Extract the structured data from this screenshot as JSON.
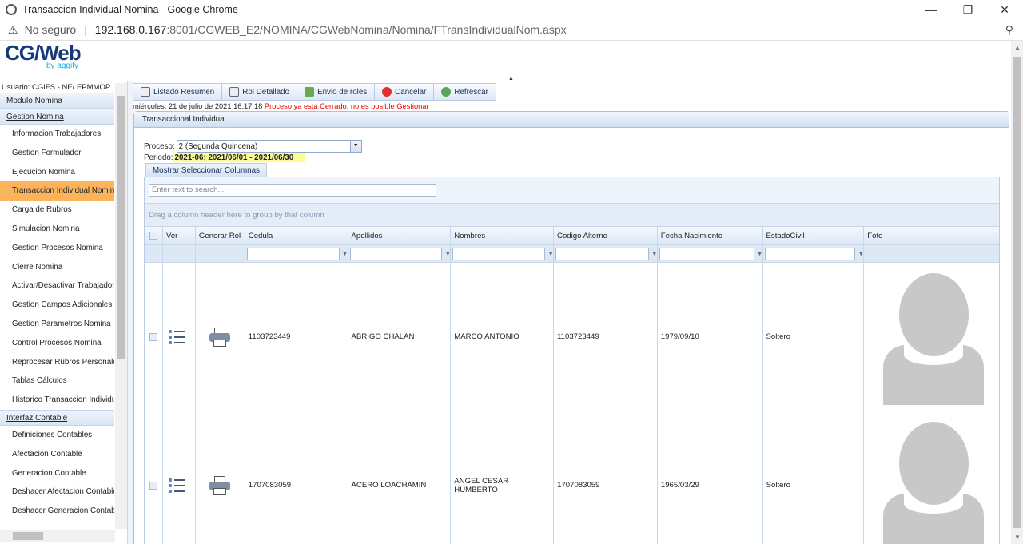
{
  "browser": {
    "window_title": "Transaccion Individual Nomina - Google Chrome",
    "security_text": "No seguro",
    "url_host": "192.168.0.167",
    "url_rest": ":8001/CGWEB_E2/NOMINA/CGWebNomina/Nomina/FTransIndividualNom.aspx"
  },
  "logo": {
    "main": "CG/Web",
    "sub": "by aggity"
  },
  "sidebar": {
    "user": "Usuario: CGIFS - NE/ EPMMOP",
    "module": "Modulo Nomina",
    "group1": "Gestion Nomina",
    "items": [
      "Informacion Trabajadores",
      "Gestion Formulador",
      "Ejecucion Nomina",
      "Transaccion Individual Nomina",
      "Carga de Rubros",
      "Simulacion Nomina",
      "Gestion Procesos Nomina",
      "Cierre Nomina",
      "Activar/Desactivar Trabajadores",
      "Gestion Campos Adicionales",
      "Gestion Parametros Nomina",
      "Control Procesos Nomina",
      "Reprocesar Rubros Personales",
      "Tablas Cálculos",
      "Historico Transaccion Individual"
    ],
    "group2": "Interfaz Contable",
    "items2": [
      "Definiciones Contables",
      "Afectacion Contable",
      "Generacion Contable",
      "Deshacer Afectacion Contable",
      "Deshacer Generacion Contable"
    ]
  },
  "toolbar": {
    "listado": "Listado Resumen",
    "rol": "Rol Detallado",
    "envio": "Envio de roles",
    "cancelar": "Cancelar",
    "refrescar": "Refrescar"
  },
  "status": {
    "date": "miércoles, 21 de julio de 2021 16:17:18",
    "message": "Proceso ya está Cerrado, no es posible Gestionar"
  },
  "panel": {
    "title": "Transaccional Individual",
    "proceso_label": "Proceso:",
    "proceso_value": "2 (Segunda Quincena)",
    "periodo_label": "Periodo:",
    "periodo_value": "2021-06: 2021/06/01 - 2021/06/30",
    "columns_button": "Mostrar Seleccionar Columnas"
  },
  "grid": {
    "search_placeholder": "Enter text to search...",
    "group_hint": "Drag a column header here to group by that column",
    "headers": [
      "",
      "Ver",
      "Generar Rol",
      "Cedula",
      "Apellidos",
      "Nombres",
      "Codigo Alterno",
      "Fecha Nacimiento",
      "EstadoCivil",
      "Foto"
    ],
    "rows": [
      {
        "cedula": "1103723449",
        "apellidos": "ABRIGO CHALAN",
        "nombres": "MARCO ANTONIO",
        "codigo": "1103723449",
        "fecha": "1979/09/10",
        "estado": "Soltero"
      },
      {
        "cedula": "1707083059",
        "apellidos": "ACERO LOACHAMIN",
        "nombres": "ANGEL CESAR HUMBERTO",
        "codigo": "1707083059",
        "fecha": "1965/03/29",
        "estado": "Soltero"
      }
    ]
  },
  "colors": {
    "active_item": "#fbb35c",
    "error": "#e00000",
    "highlight": "#fdfb94"
  }
}
